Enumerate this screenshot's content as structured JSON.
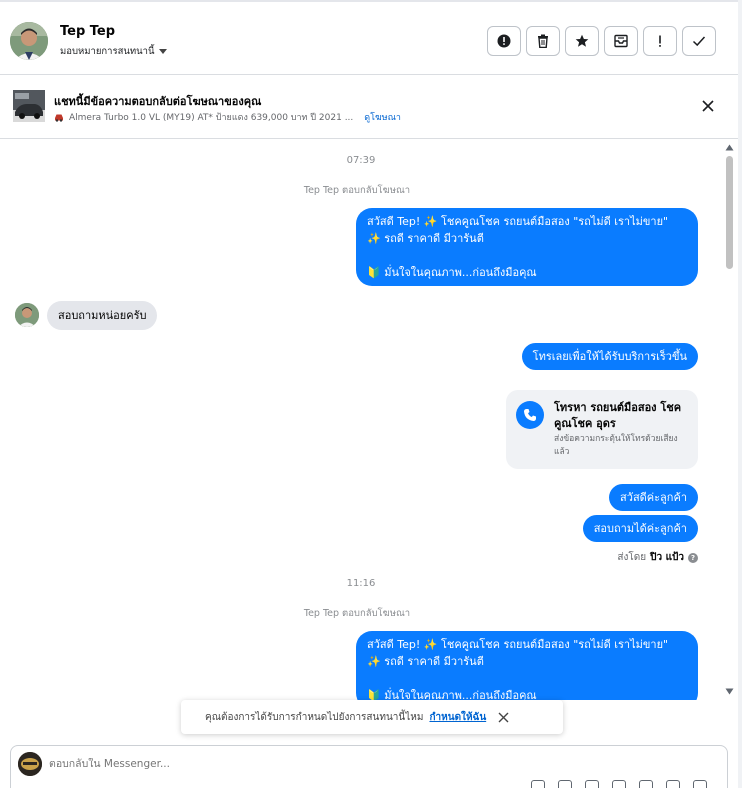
{
  "header": {
    "contact_name": "Tep Tep",
    "assign_label": "มอบหมายการสนทนานี้",
    "actions": [
      "spam-icon",
      "trash-icon",
      "star-icon",
      "archive-icon",
      "important-icon",
      "check-icon"
    ]
  },
  "ad_banner": {
    "title": "แชทนี้มีข้อความตอบกลับต่อโฆษณาของคุณ",
    "subtitle": "Almera Turbo 1.0 VL (MY19) AT* ป้ายแดง 639,000 บาท ปี 2021 ...",
    "view_ad": "ดูโฆษณา"
  },
  "thread": {
    "time1": "07:39",
    "reply_note1": "Tep Tep ตอบกลับโฆษณา",
    "greeting1": {
      "line1": "สวัสดี Tep! ✨ โชคคูณโชค รถยนต์มือสอง \"รถไม่ดี เราไม่ขาย\"",
      "line2": "✨ รถดี ราคาดี มีวารันตี",
      "line3": "🔰 มั่นใจในคุณภาพ...ก่อนถึงมือคุณ"
    },
    "incoming1": "สอบถามหน่อยครับ",
    "outgoing1": "โทรเลยเพื่อให้ได้รับบริการเร็วขึ้น",
    "call_card": {
      "title": "โทรหา รถยนต์มือสอง โชคคูณโชค อุดร",
      "subtitle": "ส่งข้อความกระตุ้นให้โทรด้วยเสียงแล้ว"
    },
    "outgoing2": "สวัสดีค่ะลูกค้า",
    "outgoing3": "สอบถามได้ค่ะลูกค้า",
    "sent_by_prefix": "ส่งโดย",
    "sent_by_name": "ปิว แป้ว",
    "time2": "11:16",
    "reply_note2": "Tep Tep ตอบกลับโฆษณา",
    "greeting2": {
      "line1": "สวัสดี Tep! ✨ โชคคูณโชค รถยนต์มือสอง \"รถไม่ดี เราไม่ขาย\"",
      "line2": "✨ รถดี ราคาดี มีวารันตี",
      "line3": "🔰 มั่นใจในคุณภาพ...ก่อนถึงมือคุณ"
    }
  },
  "toast": {
    "text": "คุณต้องการได้รับการกำหนดไปยังการสนทนานี้ไหม",
    "link": "กำหนดให้ฉัน"
  },
  "composer": {
    "placeholder": "ตอบกลับใน Messenger..."
  },
  "colors": {
    "accent": "#0a7cff",
    "incoming_bubble": "#e4e6eb"
  }
}
